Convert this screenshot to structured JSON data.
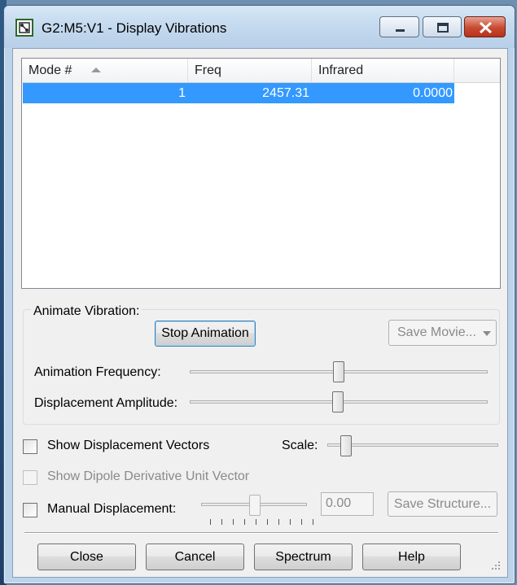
{
  "window": {
    "title": "G2:M5:V1 - Display Vibrations"
  },
  "list": {
    "columns": [
      "Mode #",
      "Freq",
      "Infrared"
    ],
    "rows": [
      {
        "mode": "1",
        "freq": "2457.31",
        "infrared": "0.0000"
      }
    ]
  },
  "animate": {
    "group_label": "Animate Vibration:",
    "stop_button": "Stop Animation",
    "save_movie": "Save Movie...",
    "frequency_label": "Animation Frequency:",
    "amplitude_label": "Displacement Amplitude:"
  },
  "options": {
    "show_vectors": "Show Displacement Vectors",
    "scale_label": "Scale:",
    "show_dipole": "Show Dipole Derivative Unit Vector",
    "manual_label": "Manual Displacement:",
    "manual_value": "0.00",
    "save_structure": "Save Structure..."
  },
  "buttons": {
    "close": "Close",
    "cancel": "Cancel",
    "spectrum": "Spectrum",
    "help": "Help"
  },
  "colors": {
    "selection": "#3399ff",
    "titlebar": "#c4d9ee",
    "close_button": "#c84a30"
  },
  "icons": [
    "app-icon",
    "minimize-icon",
    "maximize-icon",
    "close-icon",
    "sort-ascending-icon",
    "dropdown-arrow-icon",
    "resize-grip-icon"
  ]
}
